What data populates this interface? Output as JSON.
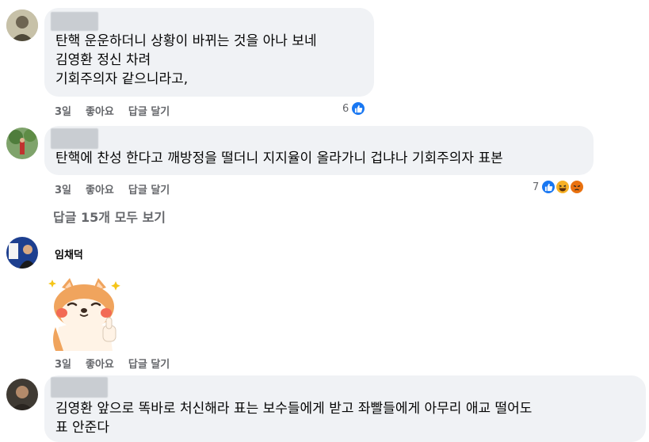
{
  "comments": [
    {
      "text": "탄핵 운운하더니 상황이 바뀌는 것을 아나 보네\n김영환 정신 차려\n기회주의자 같으니라고,",
      "time": "3일",
      "like": "좋아요",
      "reply": "답글 달기",
      "reaction_count": "6",
      "reactions": [
        "like-icon"
      ]
    },
    {
      "text": "탄핵에 찬성 한다고 깨방정을 떨더니 지지율이 올라가니 겁냐나 기회주의자 표본",
      "time": "3일",
      "like": "좋아요",
      "reply": "답글 달기",
      "reaction_count": "7",
      "reactions": [
        "like-icon",
        "haha-icon",
        "angry-icon"
      ]
    },
    {
      "author": "임채덕",
      "sticker": "shiba-dog-thumbs-up-sticker",
      "time": "3일",
      "like": "좋아요",
      "reply": "답글 달기"
    },
    {
      "text": "김영환 앞으로 똑바로 처신해라 표는 보수들에게 받고 좌빨들에게 아무리 애교 떨어도\n표 안준다"
    }
  ],
  "more_replies": "답글 15개 모두 보기",
  "colors": {
    "like_blue": "#1877f2",
    "haha_yellow": "#f7b125",
    "angry_orange": "#e9710f",
    "bubble": "#f0f2f5",
    "muted": "#65676b"
  }
}
